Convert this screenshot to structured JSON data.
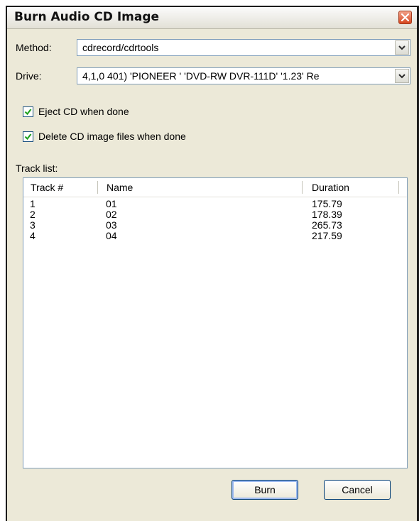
{
  "window": {
    "title": "Burn Audio CD Image"
  },
  "method": {
    "label": "Method:",
    "value": "cdrecord/cdrtools"
  },
  "drive": {
    "label": "Drive:",
    "value": "4,1,0 401) 'PIONEER ' 'DVD-RW  DVR-111D' '1.23' Re"
  },
  "options": {
    "eject": {
      "label": "Eject CD when done",
      "checked": true
    },
    "delete_images": {
      "label": "Delete CD image files when done",
      "checked": true
    }
  },
  "tracklist": {
    "label": "Track list:",
    "columns": [
      "Track #",
      "Name",
      "Duration"
    ],
    "rows": [
      {
        "track": "1",
        "name": "01",
        "duration": "175.79"
      },
      {
        "track": "2",
        "name": "02",
        "duration": "178.39"
      },
      {
        "track": "3",
        "name": "03",
        "duration": "265.73"
      },
      {
        "track": "4",
        "name": "04",
        "duration": "217.59"
      }
    ]
  },
  "buttons": {
    "burn": "Burn",
    "cancel": "Cancel"
  },
  "icons": {
    "close": "close-icon",
    "dropdown": "chevron-down-icon",
    "check": "checkmark-icon"
  }
}
